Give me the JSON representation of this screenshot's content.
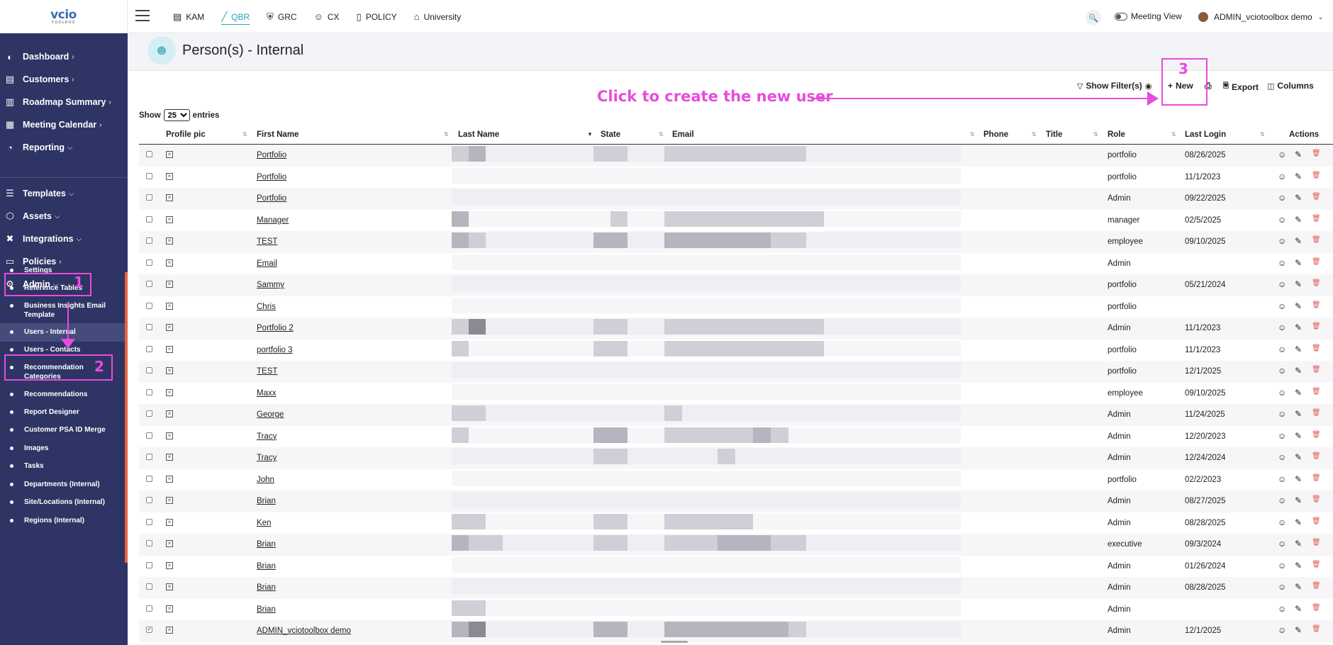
{
  "app": {
    "logo_text": "vcio",
    "logo_sub": "TOOLBOX"
  },
  "topnav": {
    "modules": [
      {
        "label": "KAM",
        "icon": "id-card-icon"
      },
      {
        "label": "QBR",
        "icon": "chart-line-icon",
        "active": true
      },
      {
        "label": "GRC",
        "icon": "shield-icon"
      },
      {
        "label": "CX",
        "icon": "smile-icon"
      },
      {
        "label": "POLICY",
        "icon": "document-icon"
      },
      {
        "label": "University",
        "icon": "graduation-cap-icon"
      }
    ],
    "meeting_view": "Meeting View",
    "user_name": "ADMIN_vciotoolbox demo"
  },
  "sidebar": {
    "items": [
      {
        "label": "Dashboard",
        "icon": "dashboard-icon",
        "chevron": ">"
      },
      {
        "label": "Customers",
        "icon": "customers-icon",
        "chevron": ">"
      },
      {
        "label": "Roadmap Summary",
        "icon": "map-icon",
        "chevron": ">"
      },
      {
        "label": "Meeting Calendar",
        "icon": "calendar-icon",
        "chevron": ">"
      },
      {
        "label": "Reporting",
        "icon": "reporting-icon",
        "chevron": "v"
      },
      {
        "label": "Templates",
        "icon": "templates-icon",
        "chevron": "v"
      },
      {
        "label": "Assets",
        "icon": "assets-icon",
        "chevron": "v"
      },
      {
        "label": "Integrations",
        "icon": "integrations-icon",
        "chevron": "v"
      },
      {
        "label": "Policies",
        "icon": "policies-icon",
        "chevron": ">"
      },
      {
        "label": "Admin",
        "icon": "gear-icon",
        "chevron": "v"
      }
    ],
    "admin_sub": [
      "Settings",
      "Reference Tables",
      "Business Insights Email Template",
      "Users - Internal",
      "Users - Contacts",
      "Recommendation Categories",
      "Recommendations",
      "Report Designer",
      "Customer PSA ID Merge",
      "Images",
      "Tasks",
      "Departments (Internal)",
      "Site/Locations (Internal)",
      "Regions (Internal)"
    ]
  },
  "page": {
    "title": "Person(s) - Internal",
    "toolbar": {
      "show_filters": "Show Filter(s)",
      "new": "New",
      "export": "Export",
      "columns": "Columns"
    },
    "entries": {
      "show": "Show",
      "value": "25",
      "suffix": "entries"
    },
    "columns": [
      "Profile pic",
      "First Name",
      "Last Name",
      "State",
      "Email",
      "Phone",
      "Title",
      "Role",
      "Last Login",
      "Actions"
    ],
    "rows": [
      {
        "first": "Portfolio",
        "role": "portfolio",
        "login": "08/26/2025",
        "b": [
          [
            1,
            2
          ],
          [
            1,
            1
          ],
          [
            1,
            1,
            1,
            1,
            1,
            1,
            1,
            1
          ]
        ]
      },
      {
        "first": "Portfolio",
        "role": "portfolio",
        "login": "11/1/2023",
        "b": [
          [
            0
          ],
          [
            0
          ],
          [
            0
          ]
        ]
      },
      {
        "first": "Portfolio",
        "role": "Admin",
        "login": "09/22/2025",
        "b": [
          [
            0
          ],
          [
            0
          ],
          [
            0
          ]
        ]
      },
      {
        "first": "Manager",
        "role": "manager",
        "login": "02/5/2025",
        "b": [
          [
            2
          ],
          [
            0,
            1
          ],
          [
            1,
            1,
            1,
            1,
            1,
            1,
            1,
            1,
            1
          ]
        ]
      },
      {
        "first": "TEST",
        "role": "employee",
        "login": "09/10/2025",
        "b": [
          [
            2,
            1
          ],
          [
            2,
            2
          ],
          [
            2,
            2,
            2,
            2,
            2,
            2,
            1,
            1
          ]
        ]
      },
      {
        "first": "Email",
        "role": "Admin",
        "login": "",
        "b": [
          [
            0
          ],
          [
            0
          ],
          [
            0
          ]
        ]
      },
      {
        "first": "Sammy",
        "role": "portfolio",
        "login": "05/21/2024",
        "b": [
          [
            0
          ],
          [
            0
          ],
          [
            0
          ]
        ]
      },
      {
        "first": "Chris",
        "role": "portfolio",
        "login": "",
        "b": [
          [
            0
          ],
          [
            0
          ],
          [
            0
          ]
        ]
      },
      {
        "first": "Portfolio 2",
        "role": "Admin",
        "login": "11/1/2023",
        "b": [
          [
            1,
            3
          ],
          [
            1,
            1
          ],
          [
            1,
            1,
            1,
            1,
            1,
            1,
            1,
            1,
            1
          ]
        ]
      },
      {
        "first": "portfolio 3",
        "role": "portfolio",
        "login": "11/1/2023",
        "b": [
          [
            1
          ],
          [
            1,
            1
          ],
          [
            1,
            1,
            1,
            1,
            1,
            1,
            1,
            1,
            1
          ]
        ]
      },
      {
        "first": "TEST",
        "role": "portfolio",
        "login": "12/1/2025",
        "b": [
          [
            0
          ],
          [
            0
          ],
          [
            0
          ]
        ]
      },
      {
        "first": "Maxx",
        "role": "employee",
        "login": "09/10/2025",
        "b": [
          [
            0
          ],
          [
            0
          ],
          [
            0
          ]
        ]
      },
      {
        "first": "George",
        "role": "Admin",
        "login": "11/24/2025",
        "b": [
          [
            1,
            1
          ],
          [
            0
          ],
          [
            1,
            0,
            0,
            0,
            0,
            0,
            0,
            0
          ]
        ]
      },
      {
        "first": "Tracy",
        "role": "Admin",
        "login": "12/20/2023",
        "b": [
          [
            1
          ],
          [
            2,
            2
          ],
          [
            1,
            1,
            1,
            1,
            1,
            2,
            1,
            0
          ]
        ]
      },
      {
        "first": "Tracy",
        "role": "Admin",
        "login": "12/24/2024",
        "b": [
          [
            0
          ],
          [
            1,
            1
          ],
          [
            0,
            0,
            0,
            1,
            0,
            0,
            0,
            0
          ]
        ]
      },
      {
        "first": "John",
        "role": "portfolio",
        "login": "02/2/2023",
        "b": [
          [
            0
          ],
          [
            0
          ],
          [
            0
          ]
        ]
      },
      {
        "first": "Brian",
        "role": "Admin",
        "login": "08/27/2025",
        "b": [
          [
            0
          ],
          [
            0
          ],
          [
            0
          ]
        ]
      },
      {
        "first": "Ken",
        "role": "Admin",
        "login": "08/28/2025",
        "b": [
          [
            1,
            1
          ],
          [
            1,
            1
          ],
          [
            1,
            1,
            1,
            1,
            1,
            0,
            0,
            0
          ]
        ]
      },
      {
        "first": "Brian",
        "role": "executive",
        "login": "09/3/2024",
        "b": [
          [
            2,
            1,
            1
          ],
          [
            1,
            1
          ],
          [
            1,
            1,
            1,
            2,
            2,
            2,
            1,
            1
          ]
        ]
      },
      {
        "first": "Brian",
        "role": "Admin",
        "login": "01/26/2024",
        "b": [
          [
            0
          ],
          [
            0
          ],
          [
            0
          ]
        ]
      },
      {
        "first": "Brian",
        "role": "Admin",
        "login": "08/28/2025",
        "b": [
          [
            0
          ],
          [
            0
          ],
          [
            0
          ]
        ]
      },
      {
        "first": "Brian",
        "role": "Admin",
        "login": "",
        "b": [
          [
            1,
            1
          ],
          [
            0
          ],
          [
            0
          ]
        ]
      },
      {
        "first": "ADMIN_vciotoolbox demo",
        "role": "Admin",
        "login": "12/1/2025",
        "b": [
          [
            2,
            3
          ],
          [
            2,
            2
          ],
          [
            2,
            2,
            2,
            2,
            2,
            2,
            2,
            1
          ]
        ],
        "checked": true
      }
    ]
  },
  "annotations": {
    "step1": "1",
    "step2": "2",
    "step3": "3",
    "hint": "Click to create the new user"
  },
  "colors": {
    "sidebar_bg": "#2e3464",
    "accent": "#2aa6b6",
    "annotation": "#e84cdd",
    "delete": "#e05a5a"
  }
}
